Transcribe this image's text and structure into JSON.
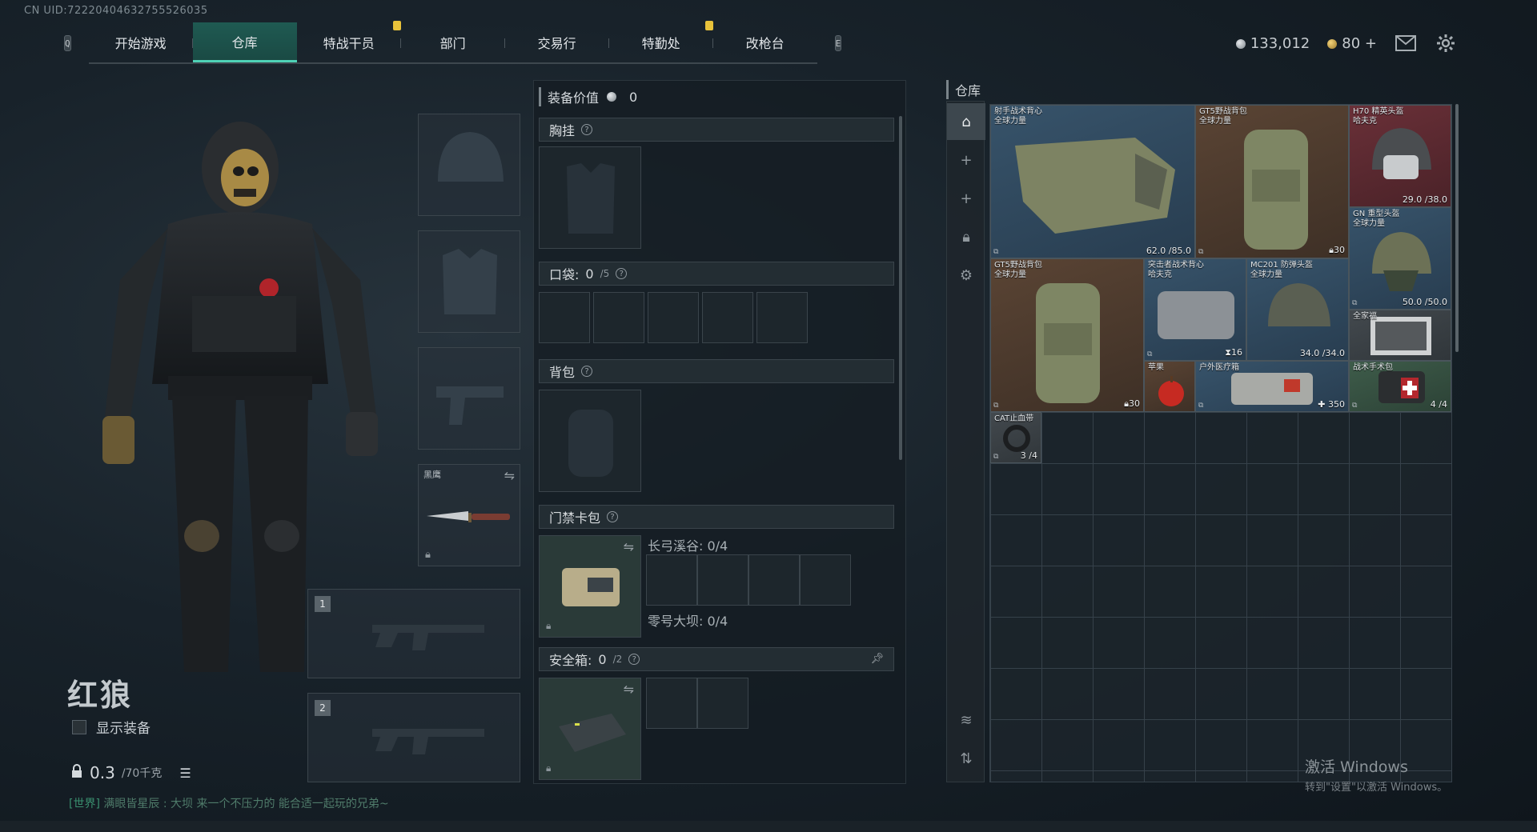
{
  "uid": "CN UID:72220404632755526035",
  "nav": {
    "left_key": "Q",
    "right_key": "E",
    "tabs": [
      {
        "label": "开始游戏",
        "active": false,
        "alert": false
      },
      {
        "label": "仓库",
        "active": true,
        "alert": false
      },
      {
        "label": "特战干员",
        "active": false,
        "alert": true
      },
      {
        "label": "部门",
        "active": false,
        "alert": false
      },
      {
        "label": "交易行",
        "active": false,
        "alert": false
      },
      {
        "label": "特勤处",
        "active": false,
        "alert": true
      },
      {
        "label": "改枪台",
        "active": false,
        "alert": false
      }
    ]
  },
  "currency": {
    "silver": "133,012",
    "gold": "80"
  },
  "operator": {
    "name": "红狼",
    "show_equipment": "显示装备",
    "weight_value": "0.3",
    "weight_max": "/70千克"
  },
  "chat": {
    "channel": "[世界]",
    "text": "满眼皆星辰 : 大坝 来一个不压力的  能合适一起玩的兄弟~"
  },
  "equip_slots": {
    "knife_label": "黑鹰",
    "gun1_num": "1",
    "gun2_num": "2"
  },
  "loadout": {
    "value_label": "装备价值",
    "value": "0",
    "chest_label": "胸挂",
    "pocket_label": "口袋:",
    "pocket_count": "0",
    "pocket_max": "/5",
    "bag_label": "背包",
    "card_label": "门禁卡包",
    "card_lines": [
      "长弓溪谷: 0/4",
      "零号大坝: 0/4"
    ],
    "safe_label": "安全箱:",
    "safe_count": "0",
    "safe_max": "/2"
  },
  "warehouse": {
    "title": "仓库",
    "items": [
      {
        "name": "射手战术背心\n全球力量",
        "value": "62.0 /85.0",
        "bg": "blue",
        "icon": "tactical-vest"
      },
      {
        "name": "GT5野战背包\n全球力量",
        "value": "30",
        "bg": "brown",
        "icon": "backpack"
      },
      {
        "name": "H70 精英头盔\n哈夫克",
        "value": "29.0 /38.0",
        "bg": "red",
        "icon": "helmet"
      },
      {
        "name": "GN 重型头盔\n全球力量",
        "value": "50.0 /50.0",
        "bg": "blue",
        "icon": "helmet"
      },
      {
        "name": "GT5野战背包\n全球力量",
        "value": "30",
        "bg": "brown",
        "icon": "backpack"
      },
      {
        "name": "突击者战术背心\n哈夫克",
        "value": "16",
        "bg": "blue",
        "icon": "tactical-vest"
      },
      {
        "name": "MC201 防弹头盔\n全球力量",
        "value": "34.0 /34.0",
        "bg": "blue",
        "icon": "helmet"
      },
      {
        "name": "全家福",
        "value": "",
        "bg": "gray",
        "icon": "photo"
      },
      {
        "name": "苹果",
        "value": "",
        "bg": "brown",
        "icon": "apple"
      },
      {
        "name": "户外医疗箱",
        "value": "350",
        "bg": "blue",
        "icon": "medkit"
      },
      {
        "name": "战术手术包",
        "value": "4 /4",
        "bg": "green",
        "icon": "surgery-kit"
      },
      {
        "name": "CAT止血带",
        "value": "3 /4",
        "bg": "gray",
        "icon": "tourniquet"
      }
    ]
  },
  "watermark": {
    "title": "激活 Windows",
    "sub": "转到\"设置\"以激活 Windows。"
  }
}
